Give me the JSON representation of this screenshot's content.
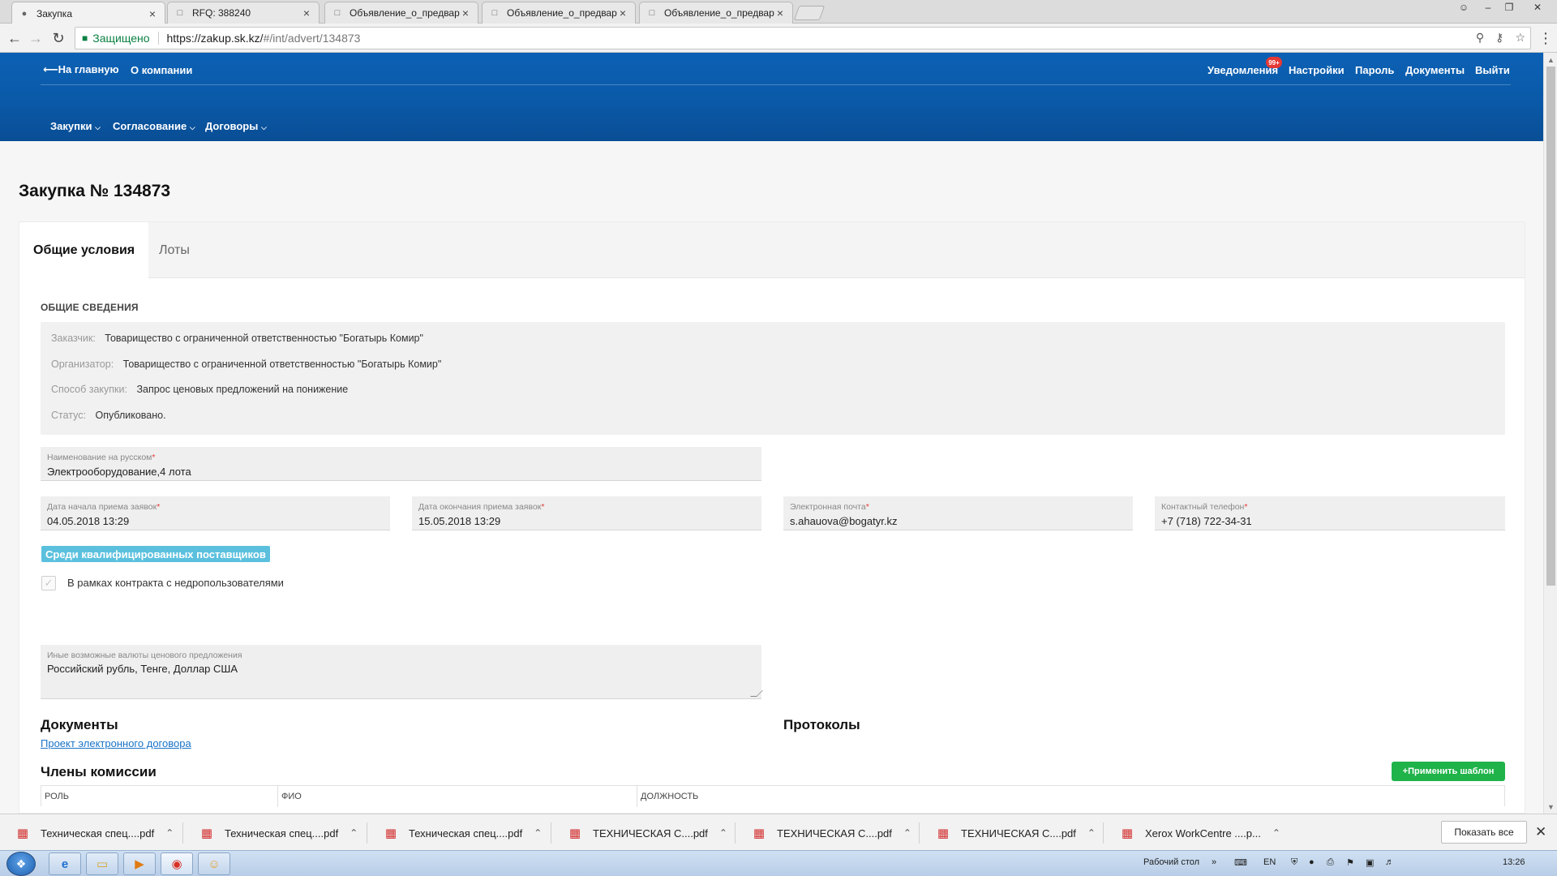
{
  "browser": {
    "tabs": [
      {
        "title": "Закупка",
        "active": true
      },
      {
        "title": "RFQ: 388240",
        "active": false
      },
      {
        "title": "Объявление_о_предвар",
        "active": false
      },
      {
        "title": "Объявление_о_предвар",
        "active": false
      },
      {
        "title": "Объявление_о_предвар",
        "active": false
      }
    ],
    "secure_label": "Защищено",
    "url_base": "https://zakup.sk.kz/",
    "url_path": "#/int/advert/134873"
  },
  "header": {
    "home_link": "На главную",
    "about_link": "О компании",
    "notifications": "Уведомления",
    "notif_badge": "99+",
    "settings": "Настройки",
    "password": "Пароль",
    "documents": "Документы",
    "logout": "Выйти",
    "menu": {
      "purchases": "Закупки",
      "approval": "Согласование",
      "contracts": "Договоры"
    }
  },
  "page": {
    "title": "Закупка № 134873",
    "tabs": {
      "general": "Общие условия",
      "lots": "Лоты"
    },
    "general_section": "ОБЩИЕ СВЕДЕНИЯ",
    "info": {
      "customer_label": "Заказчик:",
      "customer_value": "Товарищество с ограниченной ответственностью \"Богатырь Комир\"",
      "organizer_label": "Организатор:",
      "organizer_value": "Товарищество с ограниченной ответственностью \"Богатырь Комир\"",
      "method_label": "Способ закупки:",
      "method_value": "Запрос ценовых предложений на понижение",
      "status_label": "Статус:",
      "status_value": "Опубликовано."
    },
    "fields": {
      "name_label": "Наименование на русском",
      "name_value": "Электрооборудование,4 лота",
      "start_label": "Дата начала приема заявок",
      "start_value": "04.05.2018 13:29",
      "end_label": "Дата окончания приема заявок",
      "end_value": "15.05.2018 13:29",
      "email_label": "Электронная почта",
      "email_value": "s.ahauova@bogatyr.kz",
      "phone_label": "Контактный телефон",
      "phone_value": "+7 (718) 722-34-31",
      "currencies_label": "Иные возможные валюты ценового предложения",
      "currencies_value": "Российский  рубль, Тенге, Доллар США",
      "required_mark": "*"
    },
    "qualified_badge": "Среди квалифицированных поставщиков",
    "subsoil_checkbox": "В рамках контракта с недропользователями",
    "documents_heading": "Документы",
    "documents_link": "Проект электронного договора",
    "protocols_heading": "Протоколы",
    "commission_heading": "Члены комиссии",
    "apply_template": "+Применить шаблон",
    "table_headers": [
      "РОЛЬ",
      "ФИО",
      "ДОЛЖНОСТЬ"
    ]
  },
  "downloads": {
    "items": [
      "Техническая спец....pdf",
      "Техническая спец....pdf",
      "Техническая спец....pdf",
      "ТЕХНИЧЕСКАЯ   С....pdf",
      "ТЕХНИЧЕСКАЯ   С....pdf",
      "ТЕХНИЧЕСКАЯ   С....pdf",
      "Xerox WorkCentre ....p..."
    ],
    "show_all": "Показать все"
  },
  "taskbar": {
    "desktop_label": "Рабочий стол",
    "lang": "EN",
    "time": "13:26"
  }
}
